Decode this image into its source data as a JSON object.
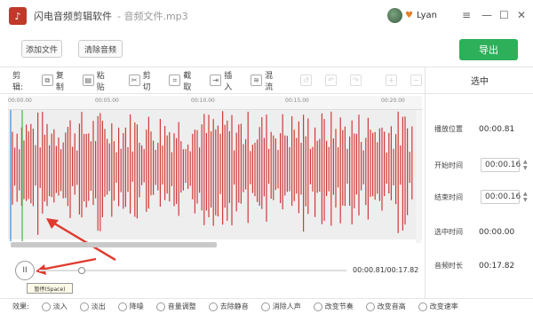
{
  "app": {
    "logo_glyph": "♪",
    "title": "闪电音频剪辑软件",
    "file": "- 音频文件.mp3"
  },
  "user": {
    "name": "Lyan"
  },
  "window_controls": {
    "menu": "≡",
    "minimize": "—",
    "maximize": "☐",
    "close": "✕"
  },
  "toolbar": {
    "add_file": "添加文件",
    "clear_audio": "清除音频",
    "export": "导出"
  },
  "edit": {
    "label": "剪辑:",
    "tools": [
      {
        "label": "复制",
        "icon": "copy-icon",
        "glyph": "⧉"
      },
      {
        "label": "粘贴",
        "icon": "paste-icon",
        "glyph": "▤"
      },
      {
        "label": "剪切",
        "icon": "cut-icon",
        "glyph": "✂"
      },
      {
        "label": "截取",
        "icon": "crop-icon",
        "glyph": "⌗"
      },
      {
        "label": "插入",
        "icon": "insert-icon",
        "glyph": "⇥"
      },
      {
        "label": "混流",
        "icon": "mix-icon",
        "glyph": "≋"
      }
    ]
  },
  "ruler": {
    "ticks": [
      "00:00.00",
      "00:05.00",
      "00:10.00",
      "00:15.00",
      "00:20.00"
    ]
  },
  "side_panel": {
    "title": "选中",
    "play_position": {
      "label": "播放位置",
      "value": "00:00.81"
    },
    "start_time": {
      "label": "开始时间",
      "value": "00:00.16"
    },
    "end_time": {
      "label": "结束时间",
      "value": "00:00.16"
    },
    "selected_time": {
      "label": "选中时间",
      "value": "00:00.00"
    },
    "audio_length": {
      "label": "音频时长",
      "value": "00:17.82"
    }
  },
  "player": {
    "pause_glyph": "II",
    "tooltip": "暂停(Space)",
    "time": "00:00.81/00:17.82",
    "progress_fraction": 0.047
  },
  "effects": {
    "label": "效果:",
    "items": [
      "淡入",
      "淡出",
      "降噪",
      "音量调整",
      "去除静音",
      "消除人声",
      "改变节奏",
      "改变音高",
      "改变速率"
    ]
  },
  "colors": {
    "accent_green": "#2eb05a",
    "wave_red": "#d03a3a",
    "logo_red": "#c0392b"
  }
}
